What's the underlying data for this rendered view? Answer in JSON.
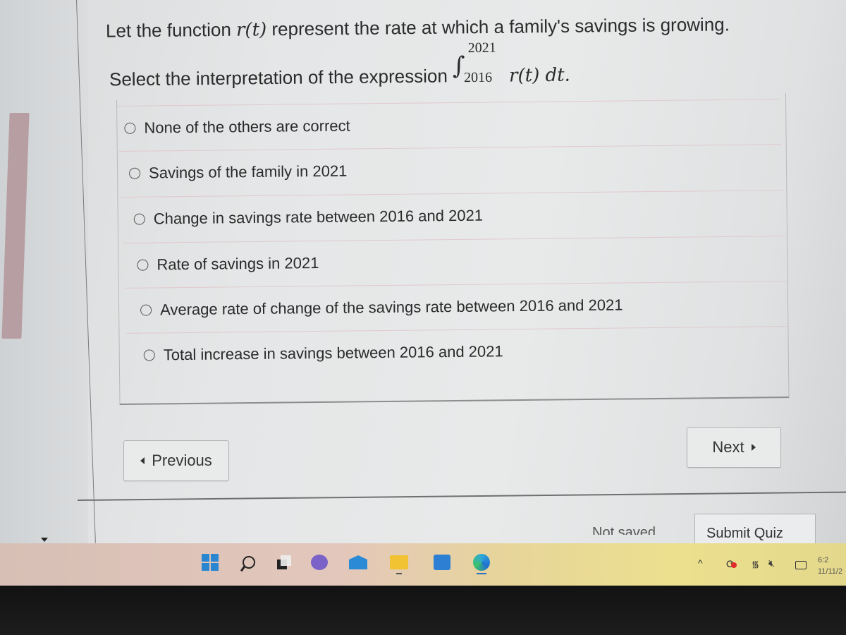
{
  "question": {
    "line1_prefix": "Let the function ",
    "function_name": "r(t)",
    "line1_suffix": " represent the rate at which a family's savings is growing.",
    "line2_prefix": "Select the interpretation of the expression ",
    "integral_upper": "2021",
    "integral_lower": "2016",
    "integrand": "r(t) dt."
  },
  "options": [
    {
      "label": "None of the others are correct",
      "selected": false
    },
    {
      "label": "Savings of the family in 2021",
      "selected": false
    },
    {
      "label": "Change in savings rate between 2016 and 2021",
      "selected": false
    },
    {
      "label": "Rate of savings in 2021",
      "selected": false
    },
    {
      "label": "Average rate of change of the savings rate between 2016 and 2021",
      "selected": false
    },
    {
      "label": "Total increase in savings between 2016 and 2021",
      "selected": false
    }
  ],
  "navigation": {
    "previous_label": "Previous",
    "next_label": "Next"
  },
  "footer": {
    "status_text": "Not saved",
    "submit_label": "Submit Quiz"
  },
  "taskbar": {
    "apps": [
      "start-icon",
      "search-icon",
      "task-view-icon",
      "teams-chat-icon",
      "mail-icon",
      "file-explorer-icon",
      "calendar-icon",
      "edge-browser-icon"
    ],
    "clock_time": "6:2",
    "clock_date": "11/11/2"
  }
}
